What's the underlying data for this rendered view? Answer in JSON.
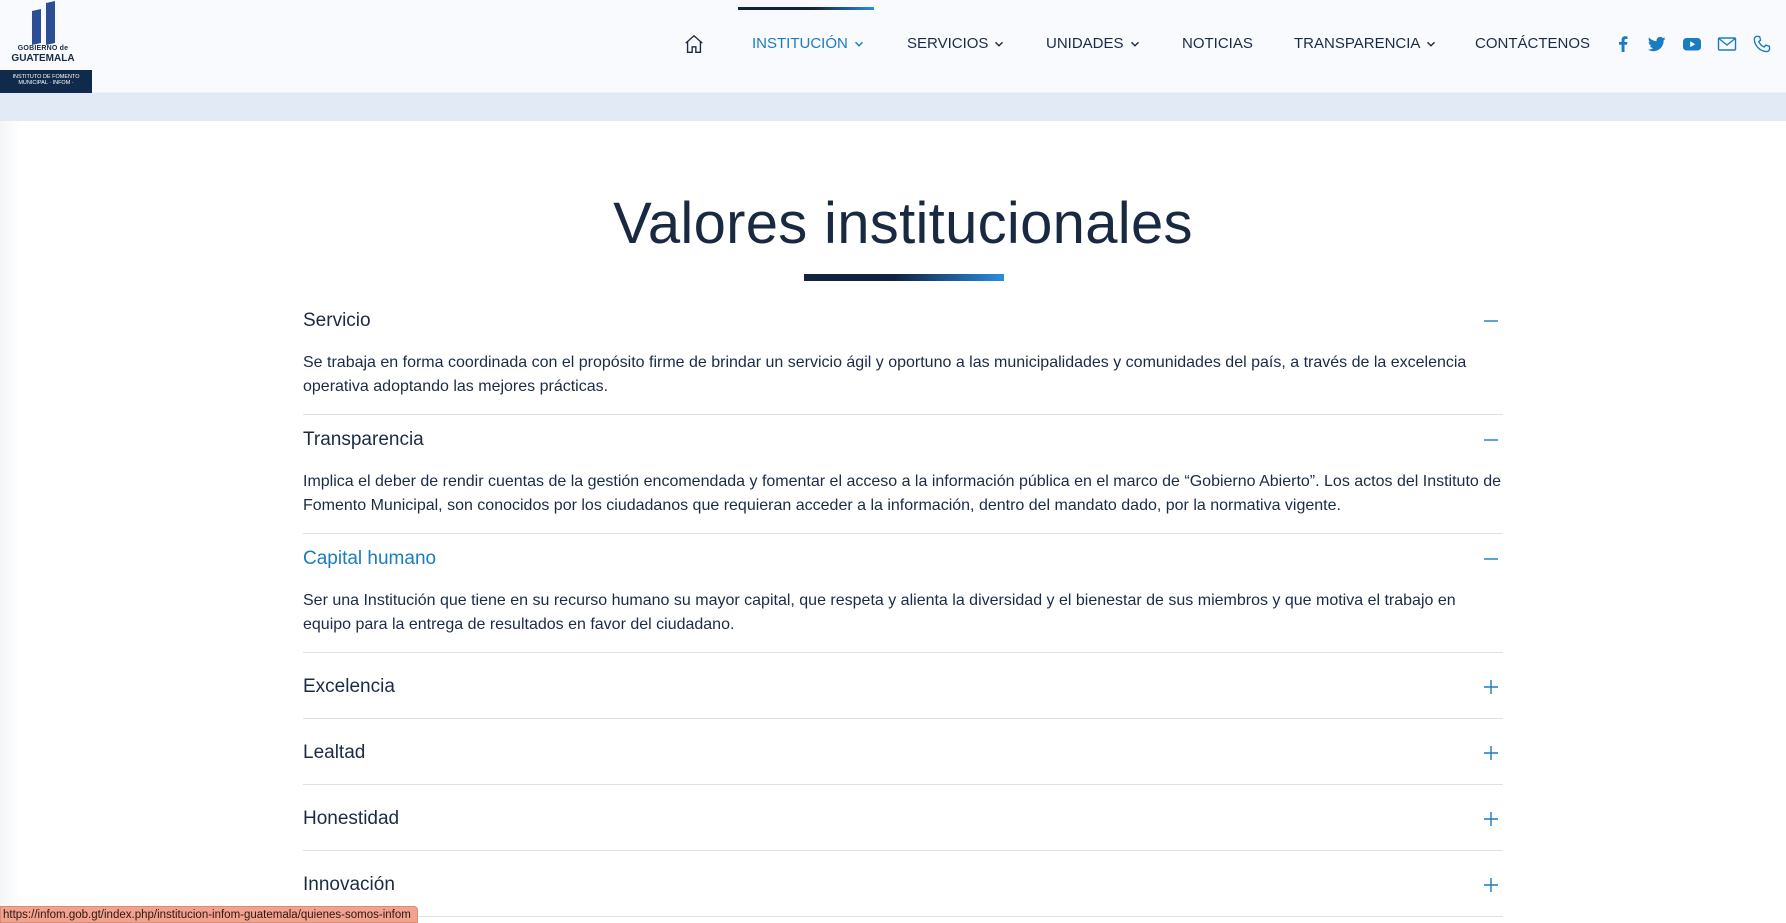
{
  "header": {
    "logo": {
      "line1": "GOBIERNO de",
      "line2": "GUATEMALA",
      "bottom": "INSTITUTO DE FOMENTO MUNICIPAL · INFOM ·"
    },
    "nav": [
      {
        "label": "INSTITUCIÓN",
        "has_dropdown": true,
        "active": true
      },
      {
        "label": "SERVICIOS",
        "has_dropdown": true
      },
      {
        "label": "UNIDADES",
        "has_dropdown": true
      },
      {
        "label": "NOTICIAS",
        "has_dropdown": false
      },
      {
        "label": "TRANSPARENCIA",
        "has_dropdown": true
      },
      {
        "label": "CONTÁCTENOS",
        "has_dropdown": false
      }
    ],
    "icons": [
      "home-icon",
      "facebook-icon",
      "twitter-icon",
      "youtube-icon",
      "mail-icon",
      "phone-icon"
    ]
  },
  "section": {
    "title": "Valores institucionales",
    "items": [
      {
        "title": "Servicio",
        "expanded": true,
        "body": "Se trabaja en forma coordinada con el propósito firme de brindar un servicio ágil y oportuno a las municipalidades y comunidades del país, a través de la excelencia operativa adoptando las mejores prácticas."
      },
      {
        "title": "Transparencia",
        "expanded": true,
        "body": "Implica el deber de rendir cuentas de la gestión encomendada y fomentar el acceso a la información pública en el marco de “Gobierno Abierto”. Los actos del Instituto de Fomento Municipal, son conocidos por los ciudadanos que requieran acceder a la información, dentro del mandato dado, por la normativa vigente."
      },
      {
        "title": "Capital humano",
        "expanded": true,
        "body": "Ser una Institución que tiene en su recurso humano su mayor capital, que respeta y alienta la diversidad y el bienestar de sus miembros y que motiva el trabajo en equipo para la entrega de resultados en favor del ciudadano."
      },
      {
        "title": "Excelencia",
        "expanded": false
      },
      {
        "title": "Lealtad",
        "expanded": false
      },
      {
        "title": "Honestidad",
        "expanded": false
      },
      {
        "title": "Innovación",
        "expanded": false
      }
    ]
  },
  "status_bar": {
    "url": "https://infom.gob.gt/index.php/institucion-infom-guatemala/quienes-somos-infom"
  },
  "colors": {
    "accent": "#1a7cc1",
    "dark": "#1c2b45",
    "band": "#e2eaf6"
  }
}
